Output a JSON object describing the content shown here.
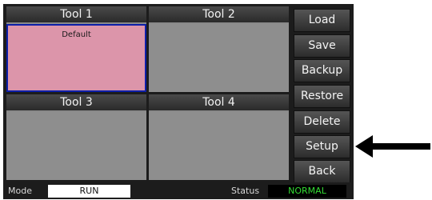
{
  "tools": [
    {
      "title": "Tool 1",
      "name": "Default",
      "selected": true
    },
    {
      "title": "Tool 2",
      "name": ""
    },
    {
      "title": "Tool 3",
      "name": ""
    },
    {
      "title": "Tool 4",
      "name": ""
    }
  ],
  "buttons": {
    "load": "Load",
    "save": "Save",
    "backup": "Backup",
    "restore": "Restore",
    "delete": "Delete",
    "setup": "Setup",
    "back": "Back"
  },
  "status_bar": {
    "mode_label": "Mode",
    "mode_value": "RUN",
    "status_label": "Status",
    "status_value": "NORMAL"
  },
  "colors": {
    "selected_tool_fill": "#dc95aa",
    "selected_tool_border": "#0d1fa8",
    "status_ok": "#33dd33"
  }
}
